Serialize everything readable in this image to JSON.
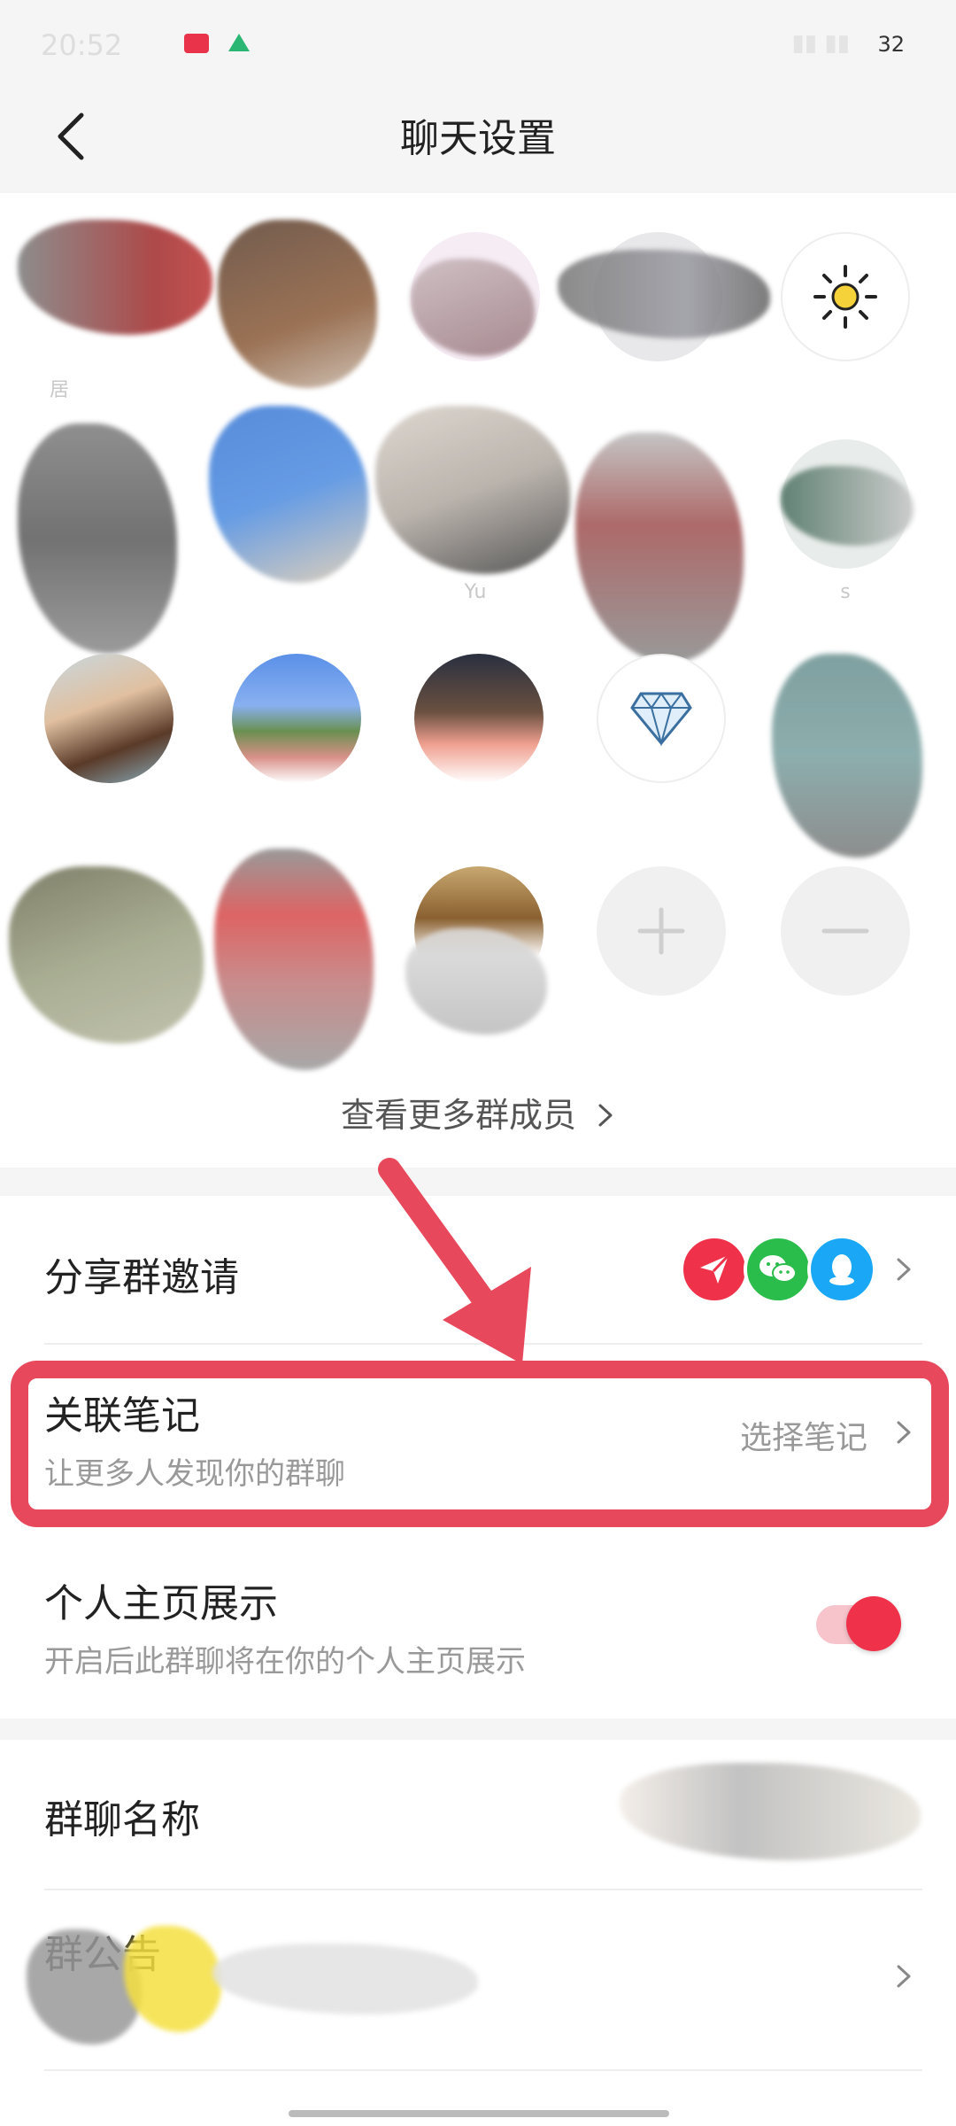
{
  "status_bar": {
    "battery": "32"
  },
  "nav": {
    "title": "聊天设置"
  },
  "members": {
    "more_label": "查看更多群成员",
    "partial_names": [
      "居",
      "Yu",
      "s"
    ]
  },
  "share_invite": {
    "label": "分享群邀请"
  },
  "linked_note": {
    "title": "关联笔记",
    "subtitle": "让更多人发现你的群聊",
    "action": "选择笔记"
  },
  "profile_display": {
    "title": "个人主页展示",
    "subtitle": "开启后此群聊将在你的个人主页展示",
    "enabled": true
  },
  "group_name": {
    "label": "群聊名称"
  },
  "group_notice": {
    "label": "群公告"
  },
  "colors": {
    "accent": "#f0314a",
    "highlight": "#e8485b",
    "wechat": "#2bbd4b",
    "qq": "#1aa7f5"
  }
}
